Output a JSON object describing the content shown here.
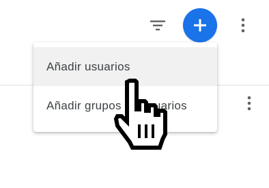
{
  "toolbar": {
    "filter_icon": "filter-icon",
    "add_icon": "plus-icon",
    "more_icon": "more-vertical-icon"
  },
  "menu": {
    "items": [
      {
        "label": "Añadir usuarios",
        "active": true
      },
      {
        "label": "Añadir grupos de usuarios",
        "active": false
      }
    ]
  },
  "row": {
    "more_icon": "more-vertical-icon"
  },
  "cursor": {
    "icon": "hand-pointer-cursor-icon"
  },
  "colors": {
    "accent": "#1a73e8",
    "icon_gray": "#5f6368",
    "menu_text": "#3c4043",
    "hover_bg": "#f1f1f1",
    "divider": "#e0e0e0"
  }
}
